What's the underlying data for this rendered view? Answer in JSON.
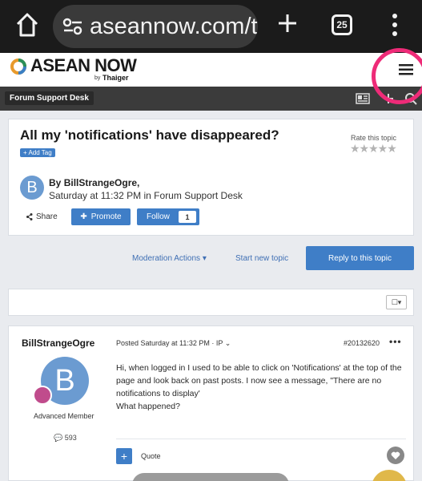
{
  "browser": {
    "url": "aseannow.com/t",
    "tab_count": "25"
  },
  "site": {
    "logo_name": "ASEAN NOW",
    "logo_by": "by",
    "logo_partner": "Thaiger",
    "colors": {
      "accent": "#3f7ec7",
      "highlight": "#ee2b78",
      "dark_bar": "#3b3b3b"
    }
  },
  "breadcrumb": {
    "label": "Forum Support Desk"
  },
  "topic": {
    "title": "All my 'notifications' have disappeared?",
    "add_tag": "+ Add Tag",
    "rate_label": "Rate this topic",
    "rating": 0,
    "author_prefix": "By",
    "author": "BillStrangeOgre,",
    "avatar_letter": "B",
    "meta": "Saturday at 11:32 PM in Forum Support Desk",
    "share": "Share",
    "promote": "Promote",
    "follow": "Follow",
    "follow_count": "1"
  },
  "actions": {
    "moderation": "Moderation Actions",
    "new_topic": "Start new topic",
    "reply": "Reply to this topic"
  },
  "post": {
    "author": "BillStrangeOgre",
    "avatar_letter": "B",
    "rank": "Advanced Member",
    "post_count": "593",
    "posted": "Posted Saturday at 11:32 PM · IP",
    "post_id": "#20132620",
    "body_lines": [
      "Hi, when logged in I used to be able to click on 'Notifications' at the top of the page and look back on past posts. I now see a message, \"There are no notifications to display'",
      "What happened?"
    ],
    "quote": "Quote"
  }
}
